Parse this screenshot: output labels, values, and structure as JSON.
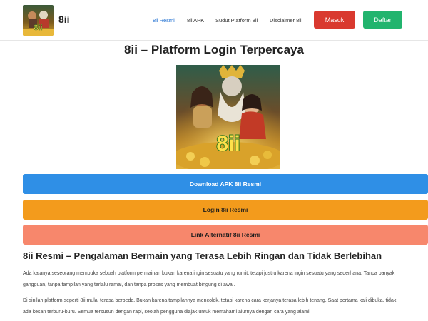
{
  "header": {
    "brand": "8ii",
    "logo_text": "8ii",
    "nav": [
      "8ii Resmi",
      "8ii APK",
      "Sudut Platform 8ii",
      "Disclaimer 8ii"
    ],
    "masuk_label": "Masuk",
    "daftar_label": "Daftar"
  },
  "main": {
    "title": "8ii – Platform Login Terpercaya",
    "hero_logo_text": "8ii",
    "cta": [
      "Download APK 8ii Resmi",
      "Login 8ii Resmi",
      "Link Alternatif 8ii Resmi"
    ],
    "heading": "8ii Resmi – Pengalaman Bermain yang Terasa Lebih Ringan dan Tidak Berlebihan",
    "paragraph1_line1": "Ada kalanya seseorang membuka sebuah platform permainan bukan karena ingin sesuatu yang rumit, tetapi justru karena ingin sesuatu yang sederhana. Tanpa banyak",
    "paragraph1_line2": "gangguan, tanpa tampilan yang terlalu ramai, dan tanpa proses yang membuat bingung di awal.",
    "paragraph2_line1": "Di sinilah platform seperti 8ii mulai terasa berbeda. Bukan karena tampilannya mencolok, tetapi karena cara kerjanya terasa lebih tenang. Saat pertama kali dibuka, tidak",
    "paragraph2_line2": "ada kesan terburu-buru. Semua tersusun dengan rapi, seolah pengguna diajak untuk memahami alurnya dengan cara yang alami."
  },
  "colors": {
    "accent_blue": "#2f8fe6",
    "orange": "#f39b1c",
    "salmon": "#f7876c",
    "red": "#d9392f",
    "green": "#22b46e",
    "nav_active": "#1f6fd1"
  }
}
